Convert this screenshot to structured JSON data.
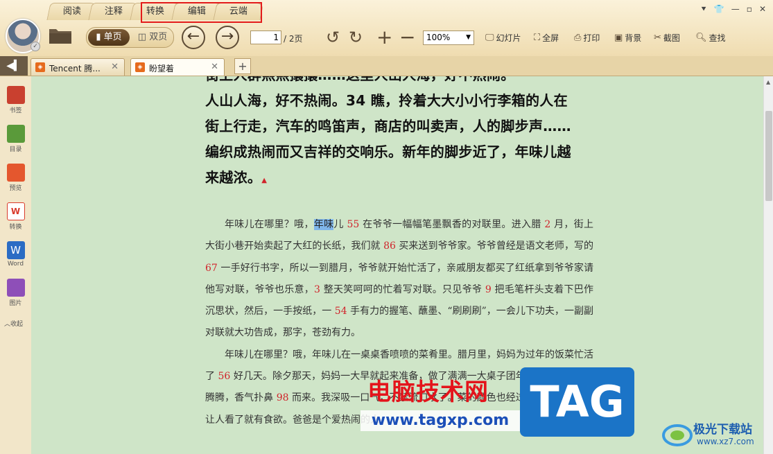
{
  "menu_tabs": [
    "阅读",
    "注释",
    "转换",
    "编辑",
    "云端"
  ],
  "toolbar": {
    "single_page": "单页",
    "double_page": "双页",
    "page_current": "1",
    "page_total": "/ 2页",
    "zoom": "100%",
    "slideshow": "幻灯片",
    "fullscreen": "全屏",
    "print": "打印",
    "background": "背景",
    "screenshot": "截图",
    "find": "查找"
  },
  "doc_tabs": [
    {
      "label": "Tencent 腾...",
      "active": false
    },
    {
      "label": "盼望着",
      "active": true
    }
  ],
  "sidebar": {
    "items": [
      {
        "label": "书签",
        "icon": "bookmark-icon",
        "color": "#c9402f"
      },
      {
        "label": "目录",
        "icon": "toc-icon",
        "color": "#5a9a3a"
      },
      {
        "label": "预览",
        "icon": "preview-icon",
        "color": "#e4572e"
      },
      {
        "label": "转换",
        "icon": "convert-icon",
        "color": "#d93a2b"
      },
      {
        "label": "Word",
        "icon": "word-icon",
        "color": "#2b6cc4"
      },
      {
        "label": "图片",
        "icon": "image-icon",
        "color": "#8e4fb8"
      }
    ],
    "collapse": "收起"
  },
  "content": {
    "bold_lines": [
      "街上人群熙熙攘攘……这里人山人海，好不热闹。",
      "人山人海，好不热闹。34 瞧，拎着大大小小行李箱的人在",
      "街上行走，汽车的鸣笛声，商店的叫卖声，人的脚步声……",
      "编织成热闹而又吉祥的交响乐。新年的脚步近了，年味儿越",
      "来越浓。"
    ],
    "para1": {
      "t1": "年味儿在哪里？哦，",
      "hl": "年味",
      "t2": "儿 ",
      "n1": "55",
      "t3": " 在爷爷一幅幅笔墨飘香的对联里。进入腊 ",
      "n2": "2",
      "t4": " 月，街上大街小巷开始卖起了大红的长纸，我们就 ",
      "n3": "86",
      "t5": " 买来送到爷爷家。爷爷曾经是语文老师，写的 ",
      "n4": "67",
      "t6": " 一手好行书字，所以一到腊月，爷爷就开始忙活了，亲戚朋友都买了红纸拿到爷爷家请他写对联，爷爷也乐意，",
      "n5": "3",
      "t7": " 整天笑呵呵的忙着写对联。只见爷爷 ",
      "n6": "9",
      "t8": " 把毛笔杆头支着下巴作沉思状，然后，一手按纸，一 ",
      "n7": "54",
      "t9": " 手有力的握笔、蘸墨、“刷刷刷”，一会儿下功夫，一副副对联就大功告成，那字，苍劲有力。"
    },
    "para2": {
      "t1": "年味儿在哪里？哦，年味儿在一桌桌香喷喷的菜肴里。腊月里，妈妈为过年的饭菜忙活了 ",
      "n1": "56",
      "t2": " 好几天。除夕那天，妈妈一大早就起来准备，做了满满一大桌子团年饭，饭菜上热气腾腾，香气扑鼻 ",
      "n2": "98",
      "t3": " 而来。我深吸一口气，不禁流口水了。菜的颜色也经过妈妈细心搭配，让人看了就有食欲。爸爸是个爱热闹的人，"
    }
  },
  "watermark": {
    "site_cn": "电脑技术网",
    "site_url": "www.tagxp.com",
    "tag": "TAG",
    "logo_name": "极光下载站",
    "logo_url": "www.xz7.com"
  },
  "colors": {
    "page_bg": "#cfe5c8",
    "highlight_box": "#e31b1b",
    "number_red": "#d0242b"
  }
}
